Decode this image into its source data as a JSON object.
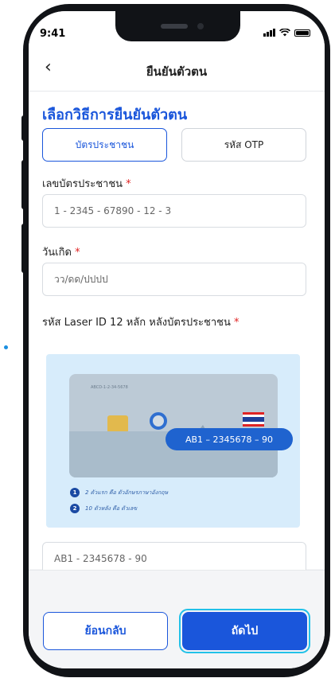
{
  "status_bar": {
    "time": "9:41"
  },
  "header": {
    "title": "ยืนยันตัวตน",
    "back_icon": "chevron-left-icon"
  },
  "section": {
    "title": "เลือกวิธีการยืนยันตัวตน"
  },
  "method_tabs": [
    {
      "label": "บัตรประชาชน",
      "active": true
    },
    {
      "label": "รหัส OTP",
      "active": false
    }
  ],
  "fields": {
    "id_card": {
      "label": "เลขบัตรประชาชน",
      "required_mark": "*",
      "placeholder": "1 - 2345 - 67890 - 12 - 3"
    },
    "birth_date": {
      "label": "วันเกิด",
      "required_mark": "*",
      "placeholder": "วว/ดด/ปปปป"
    },
    "laser_id": {
      "label": "รหัส Laser ID 12 หลัก หลังบัตรประชาชน",
      "required_mark": "*",
      "placeholder": "AB1 - 2345678 - 90"
    }
  },
  "illustration": {
    "card_sample_text": "ABCD-1-2-34-5678",
    "laser_code": "AB1 – 2345678 – 90",
    "legend": [
      {
        "num": "1",
        "text": "2 ตัวแรก คือ ตัวอักษรภาษาอังกฤษ"
      },
      {
        "num": "2",
        "text": "10 ตัวหลัง คือ ตัวเลข"
      }
    ]
  },
  "footer": {
    "back_label": "ย้อนกลับ",
    "next_label": "ถัดไป"
  },
  "colors": {
    "primary": "#1a56db",
    "required": "#e02424",
    "focus_ring": "#22c1e8"
  }
}
